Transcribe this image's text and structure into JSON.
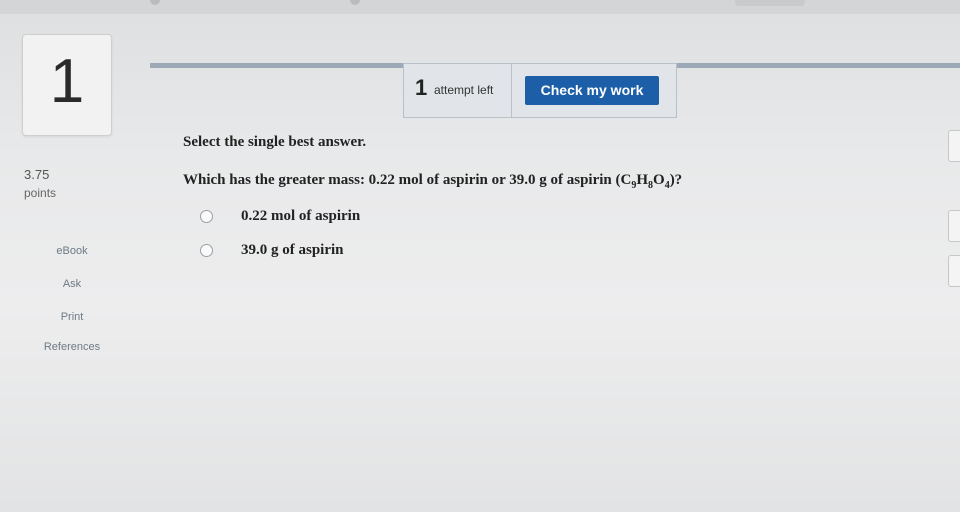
{
  "question_number": "1",
  "score": {
    "value": "3.75",
    "label": "points"
  },
  "side_tools": [
    "eBook",
    "Ask",
    "Print",
    "References"
  ],
  "attempts": {
    "count": "1",
    "label": "attempt left"
  },
  "check_button": "Check my work",
  "instruction": "Select the single best answer.",
  "question": {
    "text": "Which has the greater mass: 0.22 mol of aspirin or 39.0 g of aspirin (C",
    "sub1": "9",
    "h": "H",
    "sub2": "8",
    "o": "O",
    "sub3": "4",
    "end": ")?"
  },
  "options": [
    "0.22 mol of aspirin",
    "39.0 g of aspirin"
  ]
}
